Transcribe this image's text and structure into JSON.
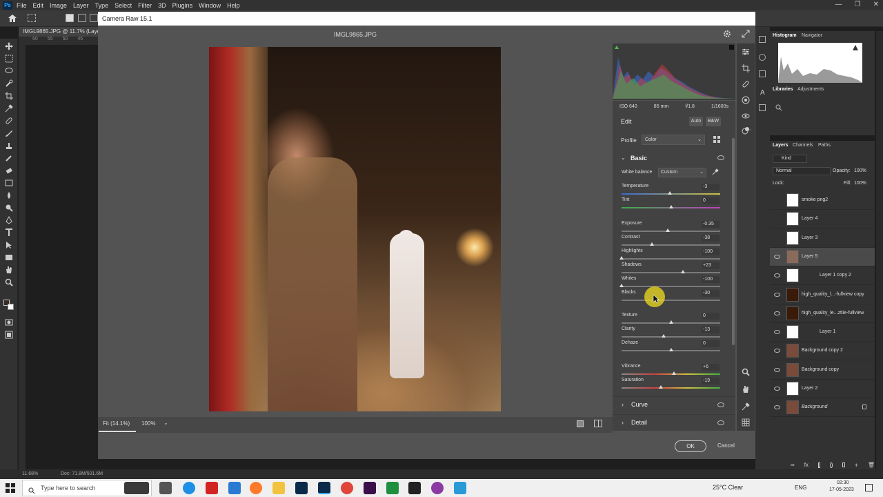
{
  "menubar": {
    "logo": "Ps",
    "items": [
      "File",
      "Edit",
      "Image",
      "Layer",
      "Type",
      "Select",
      "Filter",
      "3D",
      "Plugins",
      "Window",
      "Help"
    ]
  },
  "doc_tab": "IMGL9865.JPG @ 11.7% (Layer",
  "ruler": [
    "60",
    "55",
    "50",
    "45"
  ],
  "camera_raw": {
    "title": "Camera Raw 15.1",
    "filename": "IMGL9865.JPG",
    "meta": {
      "iso": "ISO 640",
      "focal": "85 mm",
      "aperture": "f/1.8",
      "shutter": "1/1600s"
    },
    "edit_label": "Edit",
    "auto_label": "Auto",
    "bw_label": "B&W",
    "profile_label": "Profile",
    "profile_value": "Color",
    "basic_label": "Basic",
    "wb_label": "White balance",
    "wb_value": "Custom",
    "sliders": [
      {
        "label": "Temperature",
        "value": "-3",
        "pos": 0.49
      },
      {
        "label": "Tint",
        "value": "0",
        "pos": 0.5
      },
      {
        "label": "Exposure",
        "value": "-0.35",
        "pos": 0.47
      },
      {
        "label": "Contrast",
        "value": "-38",
        "pos": 0.31
      },
      {
        "label": "Highlights",
        "value": "-100",
        "pos": 0.0
      },
      {
        "label": "Shadows",
        "value": "+23",
        "pos": 0.62
      },
      {
        "label": "Whites",
        "value": "-100",
        "pos": 0.0
      },
      {
        "label": "Blacks",
        "value": "-30",
        "pos": 0.35
      },
      {
        "label": "Texture",
        "value": "0",
        "pos": 0.5
      },
      {
        "label": "Clarity",
        "value": "-13",
        "pos": 0.43
      },
      {
        "label": "Dehaze",
        "value": "0",
        "pos": 0.5
      },
      {
        "label": "Vibrance",
        "value": "+6",
        "pos": 0.53
      },
      {
        "label": "Saturation",
        "value": "-19",
        "pos": 0.4
      }
    ],
    "curve_label": "Curve",
    "detail_label": "Detail",
    "fit_label": "Fit (14.1%)",
    "zoom_label": "100%",
    "ok_label": "OK",
    "cancel_label": "Cancel"
  },
  "ps_panels": {
    "histogram_tab": "Histogram",
    "navigator_tab": "Navigator",
    "libraries_tab": "Libraries",
    "adjustments_tab": "Adjustments",
    "layers_tab": "Layers",
    "channels_tab": "Channels",
    "paths_tab": "Paths",
    "kind_label": "Kind",
    "blend_mode": "Normal",
    "opacity_label": "Opacity:",
    "opacity_value": "100%",
    "lock_label": "Lock:",
    "fill_label": "Fill:",
    "fill_value": "100%",
    "layers": [
      {
        "name": "smoke png2",
        "visible": false
      },
      {
        "name": "Layer 4",
        "visible": false
      },
      {
        "name": "Layer 3",
        "visible": false
      },
      {
        "name": "Layer 5",
        "visible": true
      },
      {
        "name": "Layer 1 copy 2",
        "visible": true
      },
      {
        "name": "high_quality_l...-fullview copy",
        "visible": true
      },
      {
        "name": "high_quality_le...ztlie-fullview",
        "visible": true
      },
      {
        "name": "Layer 1",
        "visible": true
      },
      {
        "name": "Background copy 2",
        "visible": true
      },
      {
        "name": "Background copy",
        "visible": true
      },
      {
        "name": "Layer 2",
        "visible": true
      },
      {
        "name": "Background",
        "visible": true
      }
    ]
  },
  "statusbar": {
    "zoom": "11.68%",
    "doc": "Doc: 71.8M/501.6M"
  },
  "taskbar": {
    "search_placeholder": "Type here to search",
    "weather": "25°C  Clear",
    "lang": "ENG",
    "time": "02:30",
    "date": "17-05-2023"
  }
}
